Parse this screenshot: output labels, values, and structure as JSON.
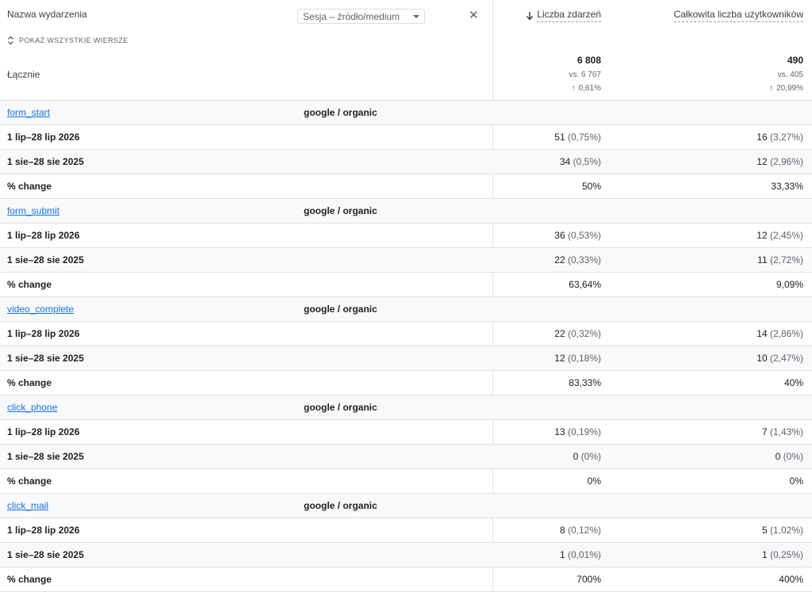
{
  "header": {
    "dimension_title": "Nazwa wydarzenia",
    "secondary_dimension": "Sesja – źródło/medium",
    "close_glyph": "✕",
    "show_all_rows": "POKAŻ WSZYSTKIE WIERSZE",
    "total_label": "Łącznie"
  },
  "columns": [
    {
      "label": "Liczba zdarzeń",
      "sorted": true,
      "total": "6 808",
      "compare": "vs. 6 767",
      "change": "0,61%"
    },
    {
      "label": "Całkowita liczba użytkowników",
      "sorted": false,
      "total": "490",
      "compare": "vs. 405",
      "change": "20,99%"
    }
  ],
  "rows": [
    {
      "type": "event",
      "name": "form_start",
      "source": "google / organic"
    },
    {
      "type": "period",
      "label": "1 lip–28 lip 2026",
      "v1": "51",
      "p1": "(0,75%)",
      "v2": "16",
      "p2": "(3,27%)"
    },
    {
      "type": "period",
      "label": "1 sie–28 sie 2025",
      "v1": "34",
      "p1": "(0,5%)",
      "v2": "12",
      "p2": "(2,96%)"
    },
    {
      "type": "change",
      "label": "% change",
      "v1": "50%",
      "v2": "33,33%"
    },
    {
      "type": "event",
      "name": "form_submit",
      "source": "google / organic"
    },
    {
      "type": "period",
      "label": "1 lip–28 lip 2026",
      "v1": "36",
      "p1": "(0,53%)",
      "v2": "12",
      "p2": "(2,45%)"
    },
    {
      "type": "period",
      "label": "1 sie–28 sie 2025",
      "v1": "22",
      "p1": "(0,33%)",
      "v2": "11",
      "p2": "(2,72%)"
    },
    {
      "type": "change",
      "label": "% change",
      "v1": "63,64%",
      "v2": "9,09%"
    },
    {
      "type": "event",
      "name": "video_complete",
      "source": "google / organic"
    },
    {
      "type": "period",
      "label": "1 lip–28 lip 2026",
      "v1": "22",
      "p1": "(0,32%)",
      "v2": "14",
      "p2": "(2,86%)"
    },
    {
      "type": "period",
      "label": "1 sie–28 sie 2025",
      "v1": "12",
      "p1": "(0,18%)",
      "v2": "10",
      "p2": "(2,47%)"
    },
    {
      "type": "change",
      "label": "% change",
      "v1": "83,33%",
      "v2": "40%"
    },
    {
      "type": "event",
      "name": "click_phone",
      "source": "google / organic"
    },
    {
      "type": "period",
      "label": "1 lip–28 lip 2026",
      "v1": "13",
      "p1": "(0,19%)",
      "v2": "7",
      "p2": "(1,43%)"
    },
    {
      "type": "period",
      "label": "1 sie–28 sie 2025",
      "v1": "0",
      "p1": "(0%)",
      "v2": "0",
      "p2": "(0%)"
    },
    {
      "type": "change",
      "label": "% change",
      "v1": "0%",
      "v2": "0%"
    },
    {
      "type": "event",
      "name": "click_mail",
      "source": "google / organic"
    },
    {
      "type": "period",
      "label": "1 lip–28 lip 2026",
      "v1": "8",
      "p1": "(0,12%)",
      "v2": "5",
      "p2": "(1,02%)"
    },
    {
      "type": "period",
      "label": "1 sie–28 sie 2025",
      "v1": "1",
      "p1": "(0,01%)",
      "v2": "1",
      "p2": "(0,25%)"
    },
    {
      "type": "change",
      "label": "% change",
      "v1": "700%",
      "v2": "400%"
    }
  ],
  "colors": {
    "link": "#1a73e8",
    "positive": "#188038",
    "alt_row": "#f8f9fa",
    "border": "#e0e0e0"
  }
}
